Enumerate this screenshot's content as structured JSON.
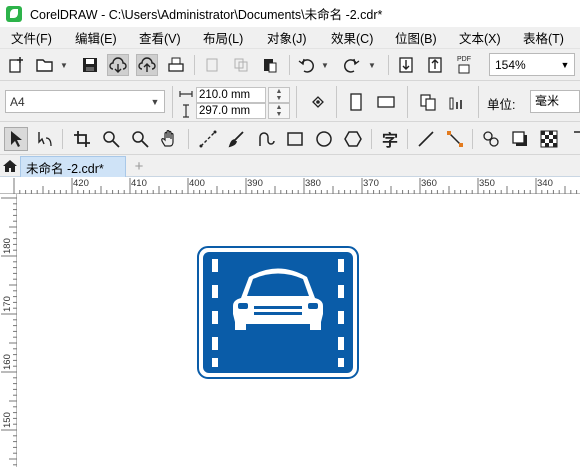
{
  "window": {
    "title": "CorelDRAW - C:\\Users\\Administrator\\Documents\\未命名 -2.cdr*"
  },
  "menu": [
    "文件(F)",
    "编辑(E)",
    "查看(V)",
    "布局(L)",
    "对象(J)",
    "效果(C)",
    "位图(B)",
    "文本(X)",
    "表格(T)"
  ],
  "toolbar": {
    "pdf_label": "PDF",
    "zoom": "154%"
  },
  "property_bar": {
    "page_size": "A4",
    "width": "210.0 mm",
    "height": "297.0 mm",
    "units_label": "单位:",
    "units_value": "毫米"
  },
  "tools": {
    "text_tool_glyph": "字"
  },
  "doc_tab": {
    "name": "未命名 -2.cdr*"
  },
  "ruler": {
    "top_labels": [
      "420",
      "410",
      "400",
      "390",
      "380",
      "370",
      "360",
      "350",
      "340"
    ],
    "left_labels": [
      "180",
      "170",
      "160",
      "150"
    ]
  },
  "artwork": {
    "sign_color": "#0a5ca8",
    "border_color": "#0a5ca8"
  }
}
